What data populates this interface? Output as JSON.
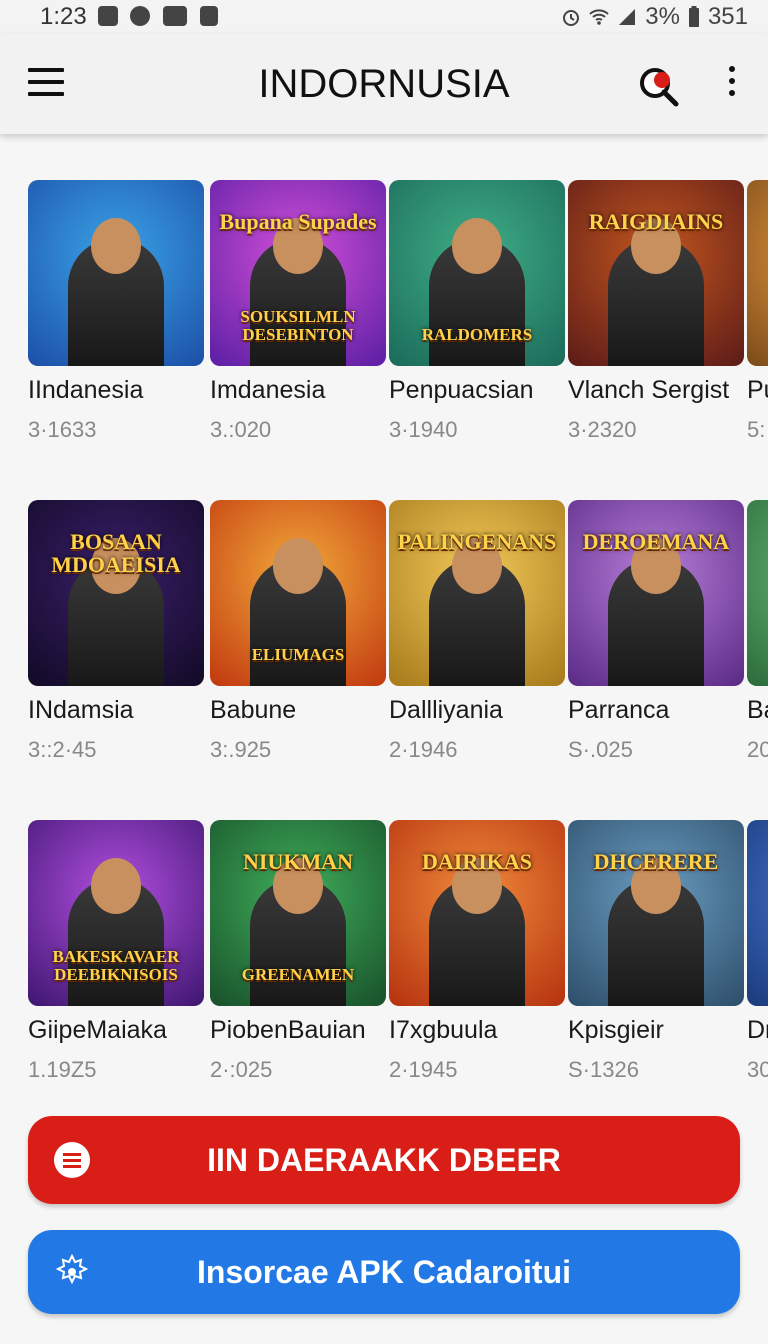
{
  "status_bar": {
    "time": "1:23",
    "battery_text": "3%",
    "right_text": "351",
    "icons": [
      "shield-icon",
      "target-icon",
      "gamepad-icon",
      "notification-icon",
      "alarm-icon",
      "wifi-icon",
      "signal-icon",
      "battery-icon"
    ]
  },
  "app_bar": {
    "title": "INDORNUSIA",
    "menu_icon": "hamburger-menu-icon",
    "search_icon": "search-icon",
    "more_icon": "more-vert-icon",
    "accent_color": "#d91e18"
  },
  "grid": {
    "rows": [
      {
        "items": [
          {
            "name": "IIndanesia",
            "meta": "3·1633",
            "thumb_text": "",
            "colors": [
              "#1c4fa8",
              "#3aa3e6"
            ]
          },
          {
            "name": "Imdanesia",
            "meta": "3.:020",
            "thumb_text": "Bupana Supades",
            "thumb_subtext": "SOUKSILMLN DESEBINTON",
            "colors": [
              "#5a1fa3",
              "#d24fd8"
            ]
          },
          {
            "name": "Penpuacsian",
            "meta": "3·1940",
            "thumb_text": "",
            "thumb_subtext": "RALDOMERS",
            "colors": [
              "#1b6a5a",
              "#3fae86"
            ]
          },
          {
            "name": "Vlanch Sergist",
            "meta": "3·2320",
            "thumb_text": "RAIGDIAINS",
            "colors": [
              "#5b1b18",
              "#c4561f"
            ]
          },
          {
            "name": "Pu",
            "meta": "5:",
            "thumb_text": "",
            "colors": [
              "#7a4a1a",
              "#f0a040"
            ]
          }
        ]
      },
      {
        "items": [
          {
            "name": "INdamsia",
            "meta": "3::2·45",
            "thumb_text": "BOSAAN MDOAEISIA",
            "colors": [
              "#120a26",
              "#3a1f6a"
            ]
          },
          {
            "name": "Babune",
            "meta": "3:.925",
            "thumb_text": "",
            "thumb_subtext": "ELIUMAGS",
            "colors": [
              "#c1380f",
              "#f2a93a"
            ]
          },
          {
            "name": "Dallliyania",
            "meta": "2·1946",
            "thumb_text": "PALINGENANS",
            "colors": [
              "#a7791a",
              "#f1c95a"
            ]
          },
          {
            "name": "Parranca",
            "meta": "S·.025",
            "thumb_text": "DEROEMANA",
            "colors": [
              "#5a2a86",
              "#b67ed8"
            ]
          },
          {
            "name": "Ba",
            "meta": "20",
            "thumb_text": "",
            "colors": [
              "#2b6a3a",
              "#6ac07a"
            ]
          }
        ]
      },
      {
        "items": [
          {
            "name": "GiipeMaiaka",
            "meta": "1.19Z5",
            "thumb_text": "",
            "thumb_subtext": "BAKESKAVAER DEEBIKNISOIS",
            "colors": [
              "#3e1670",
              "#b24fe0"
            ]
          },
          {
            "name": "PiobenBauian",
            "meta": "2·:025",
            "thumb_text": "NIUKMAN",
            "thumb_subtext": "GREENAMEN",
            "colors": [
              "#18502a",
              "#3fae5a"
            ]
          },
          {
            "name": "I7xgbuula",
            "meta": "2·1945",
            "thumb_text": "DAIRIKAS",
            "colors": [
              "#b5320f",
              "#f08a3a"
            ]
          },
          {
            "name": "Kpisgieir",
            "meta": "S·1326",
            "thumb_text": "DHCERERE",
            "colors": [
              "#2d4e6a",
              "#6a9cc0"
            ]
          },
          {
            "name": "Dr",
            "meta": "30",
            "thumb_text": "",
            "colors": [
              "#1a3a7a",
              "#4a7ad8"
            ]
          }
        ]
      }
    ]
  },
  "buttons": {
    "primary_label": "IIN DAERAAKK DBEER",
    "primary_icon": "list-icon",
    "primary_color": "#d91e18",
    "secondary_label": "Insorcae APK Cadaroitui",
    "secondary_icon": "gear-icon",
    "secondary_color": "#2279e6"
  }
}
